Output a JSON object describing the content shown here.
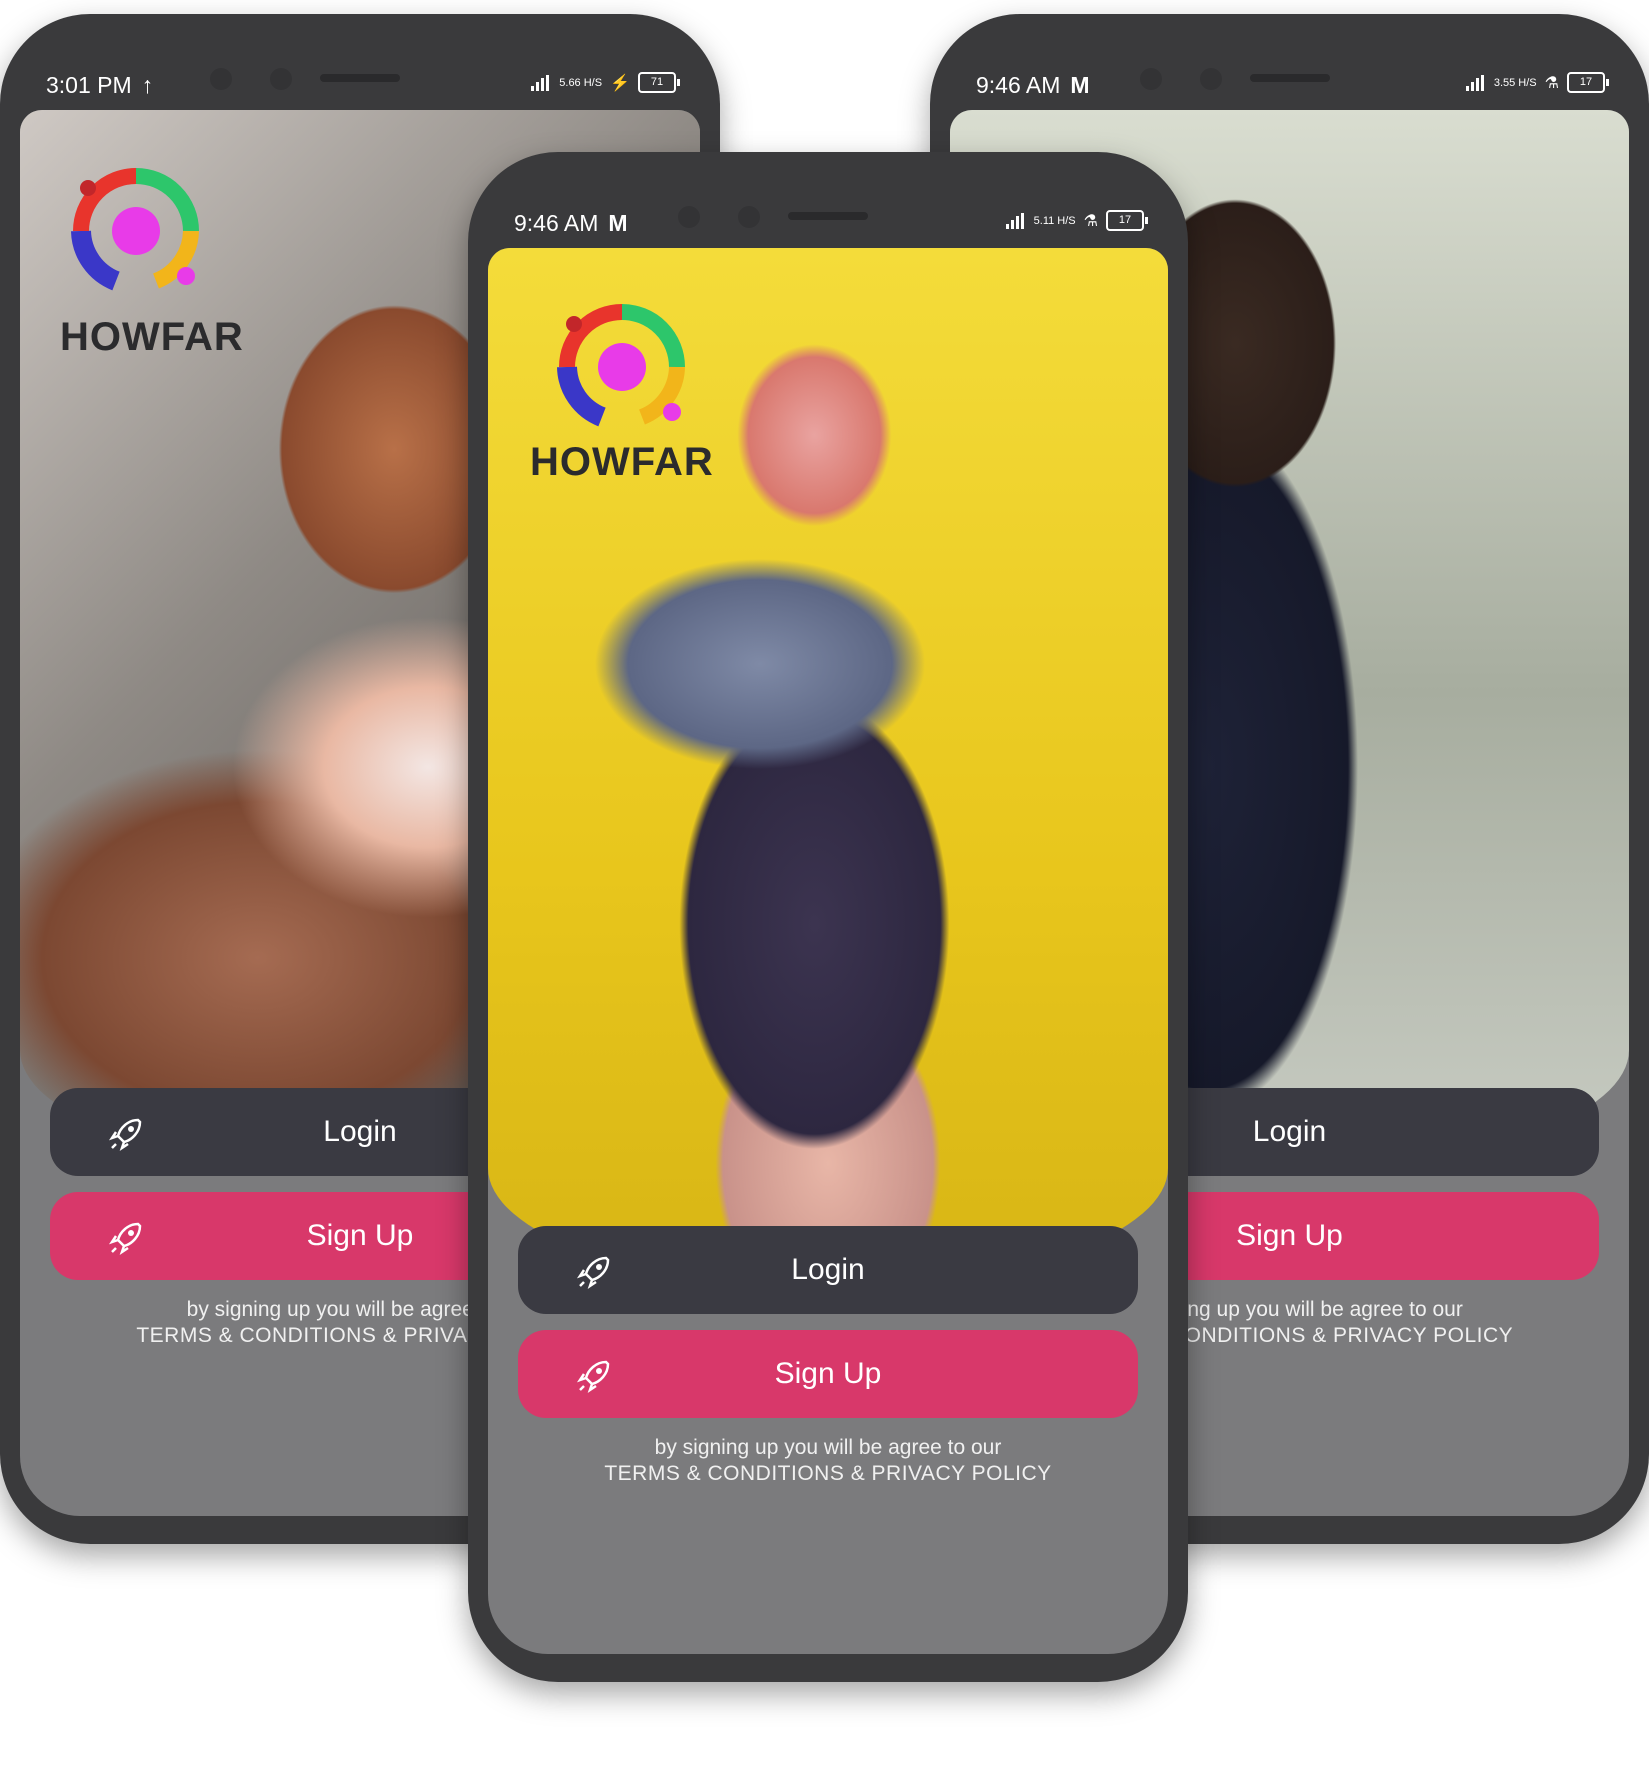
{
  "phones": {
    "left": {
      "status_time": "3:01 PM",
      "net_speed": "5.66 H/S",
      "battery": "71",
      "brand": "HOWFAR",
      "login_label": "Login",
      "signup_label": "Sign Up",
      "legal_line1": "by signing up you will be agree to our",
      "legal_line2": "TERMS & CONDITIONS & PRIVACY POLICY"
    },
    "center": {
      "status_time": "9:46 AM",
      "net_speed": "5.11 H/S",
      "battery": "17",
      "brand": "HOWFAR",
      "login_label": "Login",
      "signup_label": "Sign Up",
      "legal_line1": "by signing up you will be agree to our",
      "legal_line2": "TERMS & CONDITIONS & PRIVACY POLICY"
    },
    "right": {
      "status_time": "9:46 AM",
      "net_speed": "3.55 H/S",
      "battery": "17",
      "brand": "HOWFAR",
      "login_label": "Login",
      "signup_label": "Sign Up",
      "legal_line1": "by signing up you will be agree to our",
      "legal_line2": "TERMS & CONDITIONS & PRIVACY POLICY"
    }
  },
  "colors": {
    "phone_frame": "#3a3a3c",
    "login_button": "#3a3a42",
    "signup_button": "#d8386a",
    "screen_bottom": "#7b7b7d"
  },
  "icons": [
    "rocket-icon",
    "signal-icon",
    "battery-icon",
    "howfar-logo-icon"
  ]
}
